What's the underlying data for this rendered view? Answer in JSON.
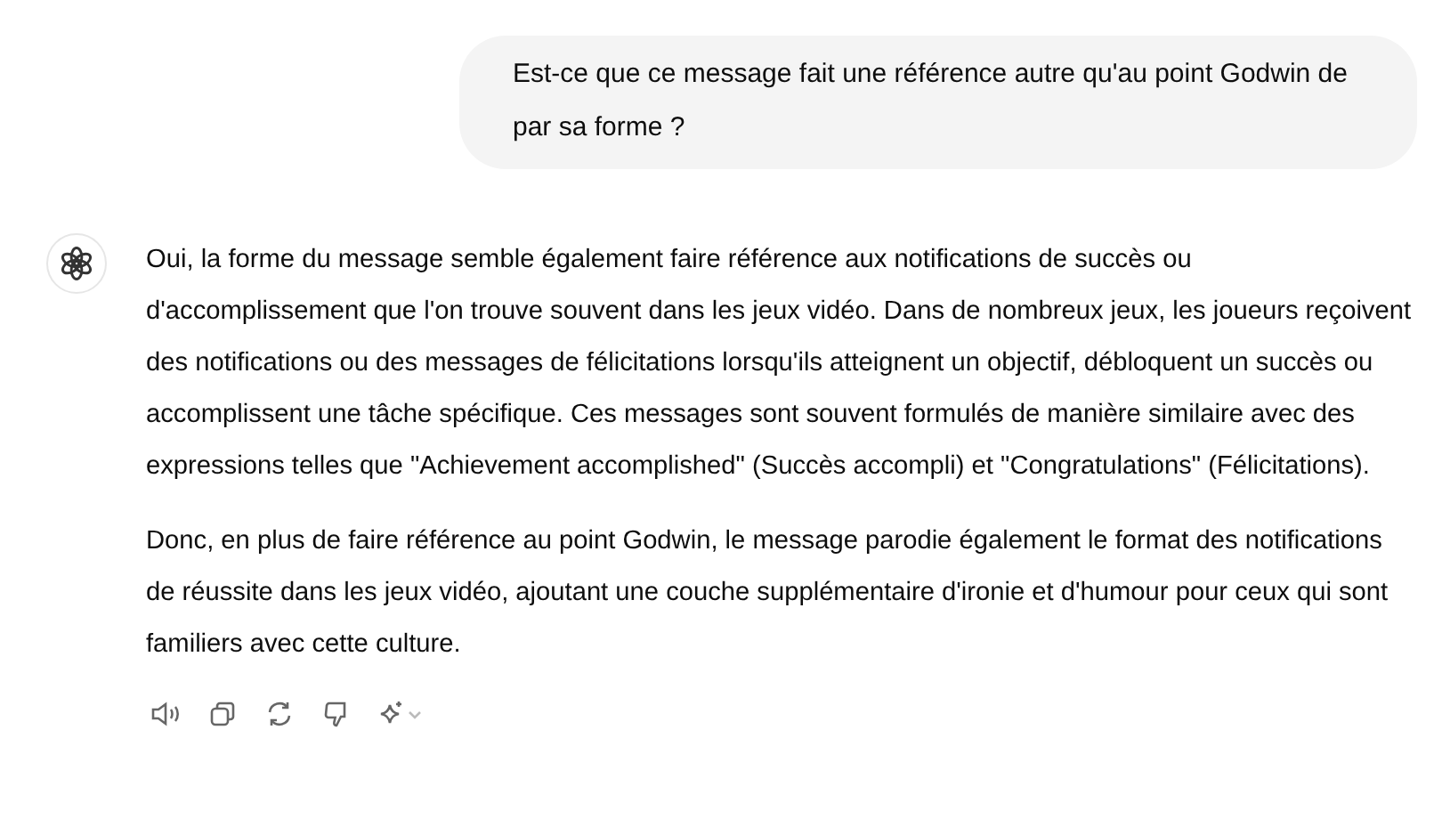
{
  "user_message": {
    "text": "Est-ce que ce message fait une référence autre qu'au point Godwin de par sa forme ?"
  },
  "assistant_message": {
    "paragraphs": [
      "Oui, la forme du message semble également faire référence aux notifications de succès ou d'accomplissement que l'on trouve souvent dans les jeux vidéo. Dans de nombreux jeux, les joueurs reçoivent des notifications ou des messages de félicitations lorsqu'ils atteignent un objectif, débloquent un succès ou accomplissent une tâche spécifique. Ces messages sont souvent formulés de manière similaire avec des expressions telles que \"Achievement accomplished\" (Succès accompli) et \"Congratulations\" (Félicitations).",
      "Donc, en plus de faire référence au point Godwin, le message parodie également le format des notifications de réussite dans les jeux vidéo, ajoutant une couche supplémentaire d'ironie et d'humour pour ceux qui sont familiers avec cette culture."
    ]
  }
}
